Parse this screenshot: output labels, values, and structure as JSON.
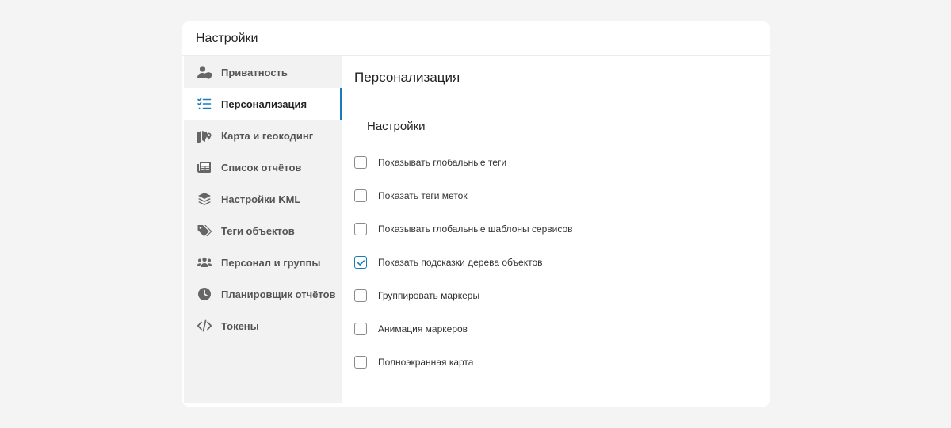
{
  "dialog": {
    "title": "Настройки"
  },
  "sidebar": {
    "items": [
      {
        "label": "Приватность",
        "icon": "user-shield-icon",
        "active": false
      },
      {
        "label": "Персонализация",
        "icon": "checklist-icon",
        "active": true
      },
      {
        "label": "Карта и геокодинг",
        "icon": "map-marker-icon",
        "active": false
      },
      {
        "label": "Список отчётов",
        "icon": "newspaper-icon",
        "active": false
      },
      {
        "label": "Настройки KML",
        "icon": "layers-icon",
        "active": false
      },
      {
        "label": "Теги объектов",
        "icon": "tags-icon",
        "active": false
      },
      {
        "label": "Персонал и группы",
        "icon": "users-icon",
        "active": false
      },
      {
        "label": "Планировщик отчётов",
        "icon": "clock-icon",
        "active": false
      },
      {
        "label": "Токены",
        "icon": "code-icon",
        "active": false
      }
    ]
  },
  "content": {
    "title": "Персонализация",
    "section_title": "Настройки",
    "options": [
      {
        "label": "Показывать глобальные теги",
        "checked": false
      },
      {
        "label": "Показать теги меток",
        "checked": false
      },
      {
        "label": "Показывать глобальные шаблоны сервисов",
        "checked": false
      },
      {
        "label": "Показать подсказки дерева объектов",
        "checked": true
      },
      {
        "label": "Группировать маркеры",
        "checked": false
      },
      {
        "label": "Анимация маркеров",
        "checked": false
      },
      {
        "label": "Полноэкранная карта",
        "checked": false
      }
    ]
  },
  "colors": {
    "accent": "#1a7bb9",
    "icon_gray": "#666666",
    "sidebar_bg": "#f2f2f2"
  }
}
